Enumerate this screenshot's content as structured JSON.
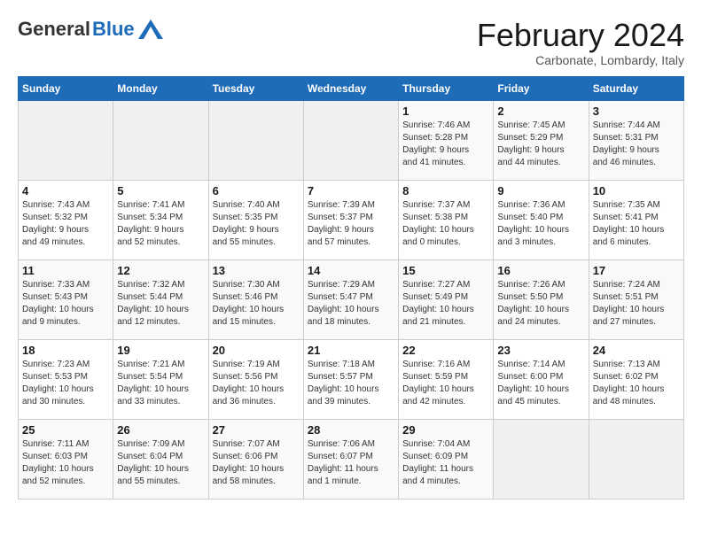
{
  "header": {
    "logo_general": "General",
    "logo_blue": "Blue",
    "title": "February 2024",
    "subtitle": "Carbonate, Lombardy, Italy"
  },
  "days_of_week": [
    "Sunday",
    "Monday",
    "Tuesday",
    "Wednesday",
    "Thursday",
    "Friday",
    "Saturday"
  ],
  "weeks": [
    [
      {
        "day": "",
        "info": ""
      },
      {
        "day": "",
        "info": ""
      },
      {
        "day": "",
        "info": ""
      },
      {
        "day": "",
        "info": ""
      },
      {
        "day": "1",
        "info": "Sunrise: 7:46 AM\nSunset: 5:28 PM\nDaylight: 9 hours\nand 41 minutes."
      },
      {
        "day": "2",
        "info": "Sunrise: 7:45 AM\nSunset: 5:29 PM\nDaylight: 9 hours\nand 44 minutes."
      },
      {
        "day": "3",
        "info": "Sunrise: 7:44 AM\nSunset: 5:31 PM\nDaylight: 9 hours\nand 46 minutes."
      }
    ],
    [
      {
        "day": "4",
        "info": "Sunrise: 7:43 AM\nSunset: 5:32 PM\nDaylight: 9 hours\nand 49 minutes."
      },
      {
        "day": "5",
        "info": "Sunrise: 7:41 AM\nSunset: 5:34 PM\nDaylight: 9 hours\nand 52 minutes."
      },
      {
        "day": "6",
        "info": "Sunrise: 7:40 AM\nSunset: 5:35 PM\nDaylight: 9 hours\nand 55 minutes."
      },
      {
        "day": "7",
        "info": "Sunrise: 7:39 AM\nSunset: 5:37 PM\nDaylight: 9 hours\nand 57 minutes."
      },
      {
        "day": "8",
        "info": "Sunrise: 7:37 AM\nSunset: 5:38 PM\nDaylight: 10 hours\nand 0 minutes."
      },
      {
        "day": "9",
        "info": "Sunrise: 7:36 AM\nSunset: 5:40 PM\nDaylight: 10 hours\nand 3 minutes."
      },
      {
        "day": "10",
        "info": "Sunrise: 7:35 AM\nSunset: 5:41 PM\nDaylight: 10 hours\nand 6 minutes."
      }
    ],
    [
      {
        "day": "11",
        "info": "Sunrise: 7:33 AM\nSunset: 5:43 PM\nDaylight: 10 hours\nand 9 minutes."
      },
      {
        "day": "12",
        "info": "Sunrise: 7:32 AM\nSunset: 5:44 PM\nDaylight: 10 hours\nand 12 minutes."
      },
      {
        "day": "13",
        "info": "Sunrise: 7:30 AM\nSunset: 5:46 PM\nDaylight: 10 hours\nand 15 minutes."
      },
      {
        "day": "14",
        "info": "Sunrise: 7:29 AM\nSunset: 5:47 PM\nDaylight: 10 hours\nand 18 minutes."
      },
      {
        "day": "15",
        "info": "Sunrise: 7:27 AM\nSunset: 5:49 PM\nDaylight: 10 hours\nand 21 minutes."
      },
      {
        "day": "16",
        "info": "Sunrise: 7:26 AM\nSunset: 5:50 PM\nDaylight: 10 hours\nand 24 minutes."
      },
      {
        "day": "17",
        "info": "Sunrise: 7:24 AM\nSunset: 5:51 PM\nDaylight: 10 hours\nand 27 minutes."
      }
    ],
    [
      {
        "day": "18",
        "info": "Sunrise: 7:23 AM\nSunset: 5:53 PM\nDaylight: 10 hours\nand 30 minutes."
      },
      {
        "day": "19",
        "info": "Sunrise: 7:21 AM\nSunset: 5:54 PM\nDaylight: 10 hours\nand 33 minutes."
      },
      {
        "day": "20",
        "info": "Sunrise: 7:19 AM\nSunset: 5:56 PM\nDaylight: 10 hours\nand 36 minutes."
      },
      {
        "day": "21",
        "info": "Sunrise: 7:18 AM\nSunset: 5:57 PM\nDaylight: 10 hours\nand 39 minutes."
      },
      {
        "day": "22",
        "info": "Sunrise: 7:16 AM\nSunset: 5:59 PM\nDaylight: 10 hours\nand 42 minutes."
      },
      {
        "day": "23",
        "info": "Sunrise: 7:14 AM\nSunset: 6:00 PM\nDaylight: 10 hours\nand 45 minutes."
      },
      {
        "day": "24",
        "info": "Sunrise: 7:13 AM\nSunset: 6:02 PM\nDaylight: 10 hours\nand 48 minutes."
      }
    ],
    [
      {
        "day": "25",
        "info": "Sunrise: 7:11 AM\nSunset: 6:03 PM\nDaylight: 10 hours\nand 52 minutes."
      },
      {
        "day": "26",
        "info": "Sunrise: 7:09 AM\nSunset: 6:04 PM\nDaylight: 10 hours\nand 55 minutes."
      },
      {
        "day": "27",
        "info": "Sunrise: 7:07 AM\nSunset: 6:06 PM\nDaylight: 10 hours\nand 58 minutes."
      },
      {
        "day": "28",
        "info": "Sunrise: 7:06 AM\nSunset: 6:07 PM\nDaylight: 11 hours\nand 1 minute."
      },
      {
        "day": "29",
        "info": "Sunrise: 7:04 AM\nSunset: 6:09 PM\nDaylight: 11 hours\nand 4 minutes."
      },
      {
        "day": "",
        "info": ""
      },
      {
        "day": "",
        "info": ""
      }
    ]
  ]
}
